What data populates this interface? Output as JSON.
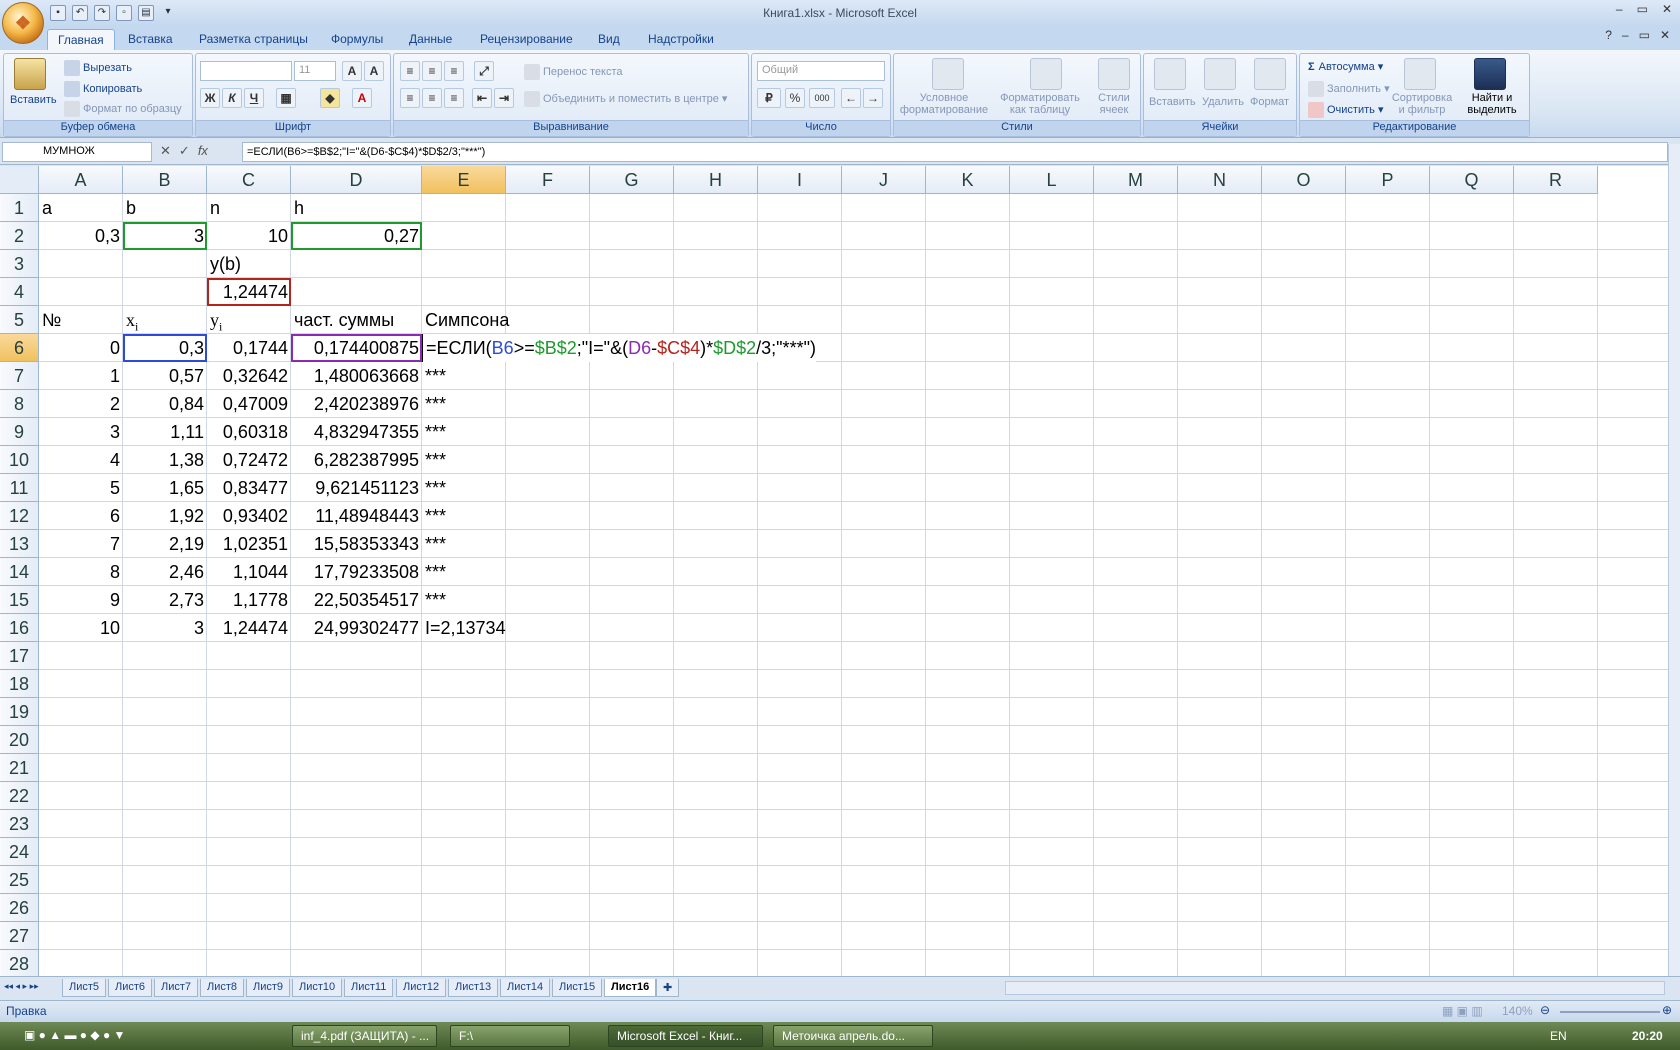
{
  "window": {
    "title": "Книга1.xlsx - Microsoft Excel"
  },
  "tabs": [
    "Главная",
    "Вставка",
    "Разметка страницы",
    "Формулы",
    "Данные",
    "Рецензирование",
    "Вид",
    "Надстройки"
  ],
  "ribbon": {
    "clipboard": {
      "label": "Буфер обмена",
      "paste": "Вставить",
      "cut": "Вырезать",
      "copy": "Копировать",
      "format_painter": "Формат по образцу"
    },
    "font": {
      "label": "Шрифт",
      "size": "11",
      "bold": "Ж",
      "italic": "К",
      "underline": "Ч"
    },
    "alignment": {
      "label": "Выравнивание",
      "wrap": "Перенос текста",
      "merge": "Объединить и поместить в центре"
    },
    "number": {
      "label": "Число",
      "format": "Общий",
      "percent": "%",
      "thousands": "000"
    },
    "styles": {
      "label": "Стили",
      "conditional": "Условное форматирование",
      "as_table": "Форматировать как таблицу",
      "cell_styles": "Стили ячеек"
    },
    "cells": {
      "label": "Ячейки",
      "insert": "Вставить",
      "delete": "Удалить",
      "format": "Формат"
    },
    "editing": {
      "label": "Редактирование",
      "autosum": "Автосумма",
      "fill": "Заполнить",
      "clear": "Очистить",
      "sort": "Сортировка и фильтр",
      "find": "Найти и выделить"
    }
  },
  "formula_bar": {
    "name_box": "МУМНОЖ",
    "formula": "=ЕСЛИ(B6>=$B$2;\"I=\"&(D6-$C$4)*$D$2/3;\"***\")"
  },
  "columns": [
    "A",
    "B",
    "C",
    "D",
    "E",
    "F",
    "G",
    "H",
    "I",
    "J",
    "K",
    "L",
    "M",
    "N",
    "O",
    "P",
    "Q",
    "R"
  ],
  "rows": [
    "1",
    "2",
    "3",
    "4",
    "5",
    "6",
    "7",
    "8",
    "9",
    "10",
    "11",
    "12",
    "13",
    "14",
    "15",
    "16",
    "17",
    "18",
    "19",
    "20",
    "21",
    "22",
    "23",
    "24",
    "25",
    "26",
    "27",
    "28"
  ],
  "cells": {
    "A1": "a",
    "B1": "b",
    "C1": "n",
    "D1": "h",
    "A2": "0,3",
    "B2": "3",
    "C2": "10",
    "D2": "0,27",
    "C3": "y(b)",
    "C4": "1,24474",
    "A5": "№",
    "B5": "x",
    "B5s": "i",
    "C5": "y",
    "C5s": "i",
    "D5": "част. суммы",
    "E5": "Симпсона",
    "table": [
      [
        "0",
        "0,3",
        "0,1744",
        "0,174400875",
        ""
      ],
      [
        "1",
        "0,57",
        "0,32642",
        "1,480063668",
        "***"
      ],
      [
        "2",
        "0,84",
        "0,47009",
        "2,420238976",
        "***"
      ],
      [
        "3",
        "1,11",
        "0,60318",
        "4,832947355",
        "***"
      ],
      [
        "4",
        "1,38",
        "0,72472",
        "6,282387995",
        "***"
      ],
      [
        "5",
        "1,65",
        "0,83477",
        "9,621451123",
        "***"
      ],
      [
        "6",
        "1,92",
        "0,93402",
        "11,48948443",
        "***"
      ],
      [
        "7",
        "2,19",
        "1,02351",
        "15,58353343",
        "***"
      ],
      [
        "8",
        "2,46",
        "1,1044",
        "17,79233508",
        "***"
      ],
      [
        "9",
        "2,73",
        "1,1778",
        "22,50354517",
        "***"
      ],
      [
        "10",
        "3",
        "1,24474",
        "24,99302477",
        "I=2,13734"
      ]
    ],
    "E6_parts": [
      "=ЕСЛИ(",
      "B6",
      ">=",
      "$B$2",
      ";\"I=\"&(",
      "D6",
      "-",
      "$C$4",
      ")*",
      "$D$2",
      "/3;\"***\")"
    ]
  },
  "sheets": [
    "Лист5",
    "Лист6",
    "Лист7",
    "Лист8",
    "Лист9",
    "Лист10",
    "Лист11",
    "Лист12",
    "Лист13",
    "Лист14",
    "Лист15",
    "Лист16"
  ],
  "status": {
    "mode": "Правка",
    "zoom": "140%"
  },
  "taskbar": {
    "items": [
      "inf_4.pdf (ЗАЩИТА) - ...",
      "F:\\",
      "Microsoft Excel - Книг...",
      "Метоичка апрель.do..."
    ],
    "lang": "EN",
    "time": "20:20"
  },
  "colors": {
    "ref_blue": "#2b4bd8",
    "ref_green": "#1f9a2f",
    "ref_purple": "#8a2ab5",
    "ref_red": "#b2241c"
  }
}
